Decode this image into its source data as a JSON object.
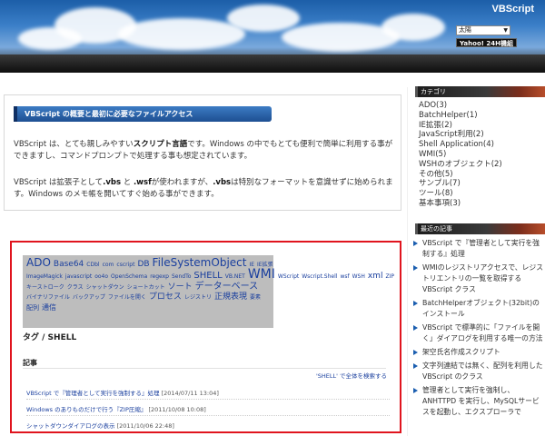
{
  "header": {
    "site_title": "VBScript",
    "size_select": "太陽",
    "yahoo_button": "Yahoo! 24H機組"
  },
  "intro": {
    "heading": "VBScript の概要と最初に必要なファイルアクセス",
    "p1_a": "VBScript は、とても親しみやすい",
    "p1_b": "スクリプト言語",
    "p1_c": "です。Windows の中でもとても便利で簡単に利用する事ができますし、コマンドプロンプトで処理する事も想定されています。",
    "p2_a": "VBScript は拡張子として",
    "p2_b": ".vbs",
    "p2_c": " と ",
    "p2_d": ".wsf",
    "p2_e": "が使われますが、",
    "p2_f": ".vbs",
    "p2_g": "は特別なフォーマットを意識せずに始められます。Windows のメモ帳を開いてすぐ始める事ができます。"
  },
  "tag_cloud": [
    {
      "text": "ADO",
      "size": 12
    },
    {
      "text": "Base64",
      "size": 9
    },
    {
      "text": "CDbl",
      "size": 6
    },
    {
      "text": "com",
      "size": 6
    },
    {
      "text": "cscript",
      "size": 6
    },
    {
      "text": "DB",
      "size": 9
    },
    {
      "text": "FileSystemObject",
      "size": 12
    },
    {
      "text": "IE",
      "size": 6
    },
    {
      "text": "IE拡張",
      "size": 6
    },
    {
      "text": "ImageMagick",
      "size": 6
    },
    {
      "text": "javascript",
      "size": 6
    },
    {
      "text": "oo4o",
      "size": 6
    },
    {
      "text": "OpenSchema",
      "size": 6
    },
    {
      "text": "regexp",
      "size": 6
    },
    {
      "text": "SendTo",
      "size": 6
    },
    {
      "text": "SHELL",
      "size": 10
    },
    {
      "text": "VB.NET",
      "size": 6
    },
    {
      "text": "WMI",
      "size": 14
    },
    {
      "text": "WScript",
      "size": 6
    },
    {
      "text": "Wscript.Shell",
      "size": 6
    },
    {
      "text": "wsf",
      "size": 6
    },
    {
      "text": "WSH",
      "size": 6
    },
    {
      "text": "xml",
      "size": 9
    },
    {
      "text": "ZIP",
      "size": 6
    },
    {
      "text": "キーストローク",
      "size": 6
    },
    {
      "text": "クラス",
      "size": 6
    },
    {
      "text": "シャットダウン",
      "size": 6
    },
    {
      "text": "ショートカット",
      "size": 6
    },
    {
      "text": "ソート",
      "size": 9
    },
    {
      "text": "データーベース",
      "size": 10
    },
    {
      "text": "バイナリファイル",
      "size": 6
    },
    {
      "text": "バックアップ",
      "size": 6
    },
    {
      "text": "ファイルを開く",
      "size": 6
    },
    {
      "text": "プロセス",
      "size": 9
    },
    {
      "text": "レジストリ",
      "size": 6
    },
    {
      "text": "正規表現",
      "size": 9
    },
    {
      "text": "要素",
      "size": 6
    },
    {
      "text": "配列",
      "size": 7
    },
    {
      "text": "通信",
      "size": 8
    }
  ],
  "tag_title": "タグ / SHELL",
  "articles_heading": "記事",
  "search_all": "'SHELL' で全体を検索する",
  "articles": [
    {
      "title": "VBScript で『管理者として実行を強制する』処理",
      "date": "[2014/07/11 13:04]"
    },
    {
      "title": "Windows のありものだけで行う『ZIP圧縮』",
      "date": "[2011/10/08 10:08]"
    },
    {
      "title": "シャットダウンダイアログの表示",
      "date": "[2011/10/06 22:48]"
    }
  ],
  "sidebar": {
    "category_title": "カテゴリ",
    "categories": [
      "ADO(3)",
      "BatchHelper(1)",
      "IE拡張(2)",
      "JavaScript利用(2)",
      "Shell Application(4)",
      "WMI(5)",
      "WSHのオブジェクト(2)",
      "その他(5)",
      "サンプル(7)",
      "ツール(8)",
      "基本事項(3)"
    ],
    "recent_title": "最近の記事",
    "recent": [
      "VBScript で『管理者として実行を強制する』処理",
      "WMIのレジストリアクセスで、レジストリエントリの一覧を取得する VBScript クラス",
      "BatchHelperオブジェクト(32bit)のインストール",
      "VBScript で標準的に「ファイルを開く」ダイアログを利用する唯一の方法",
      "架空氏名作成スクリプト",
      "文字列連結では無く、配列を利用した VBScript のクラス",
      "管理者として実行を強制し、ANHTTPD を実行し、MySQLサービスを起動し、エクスプローラで"
    ]
  }
}
